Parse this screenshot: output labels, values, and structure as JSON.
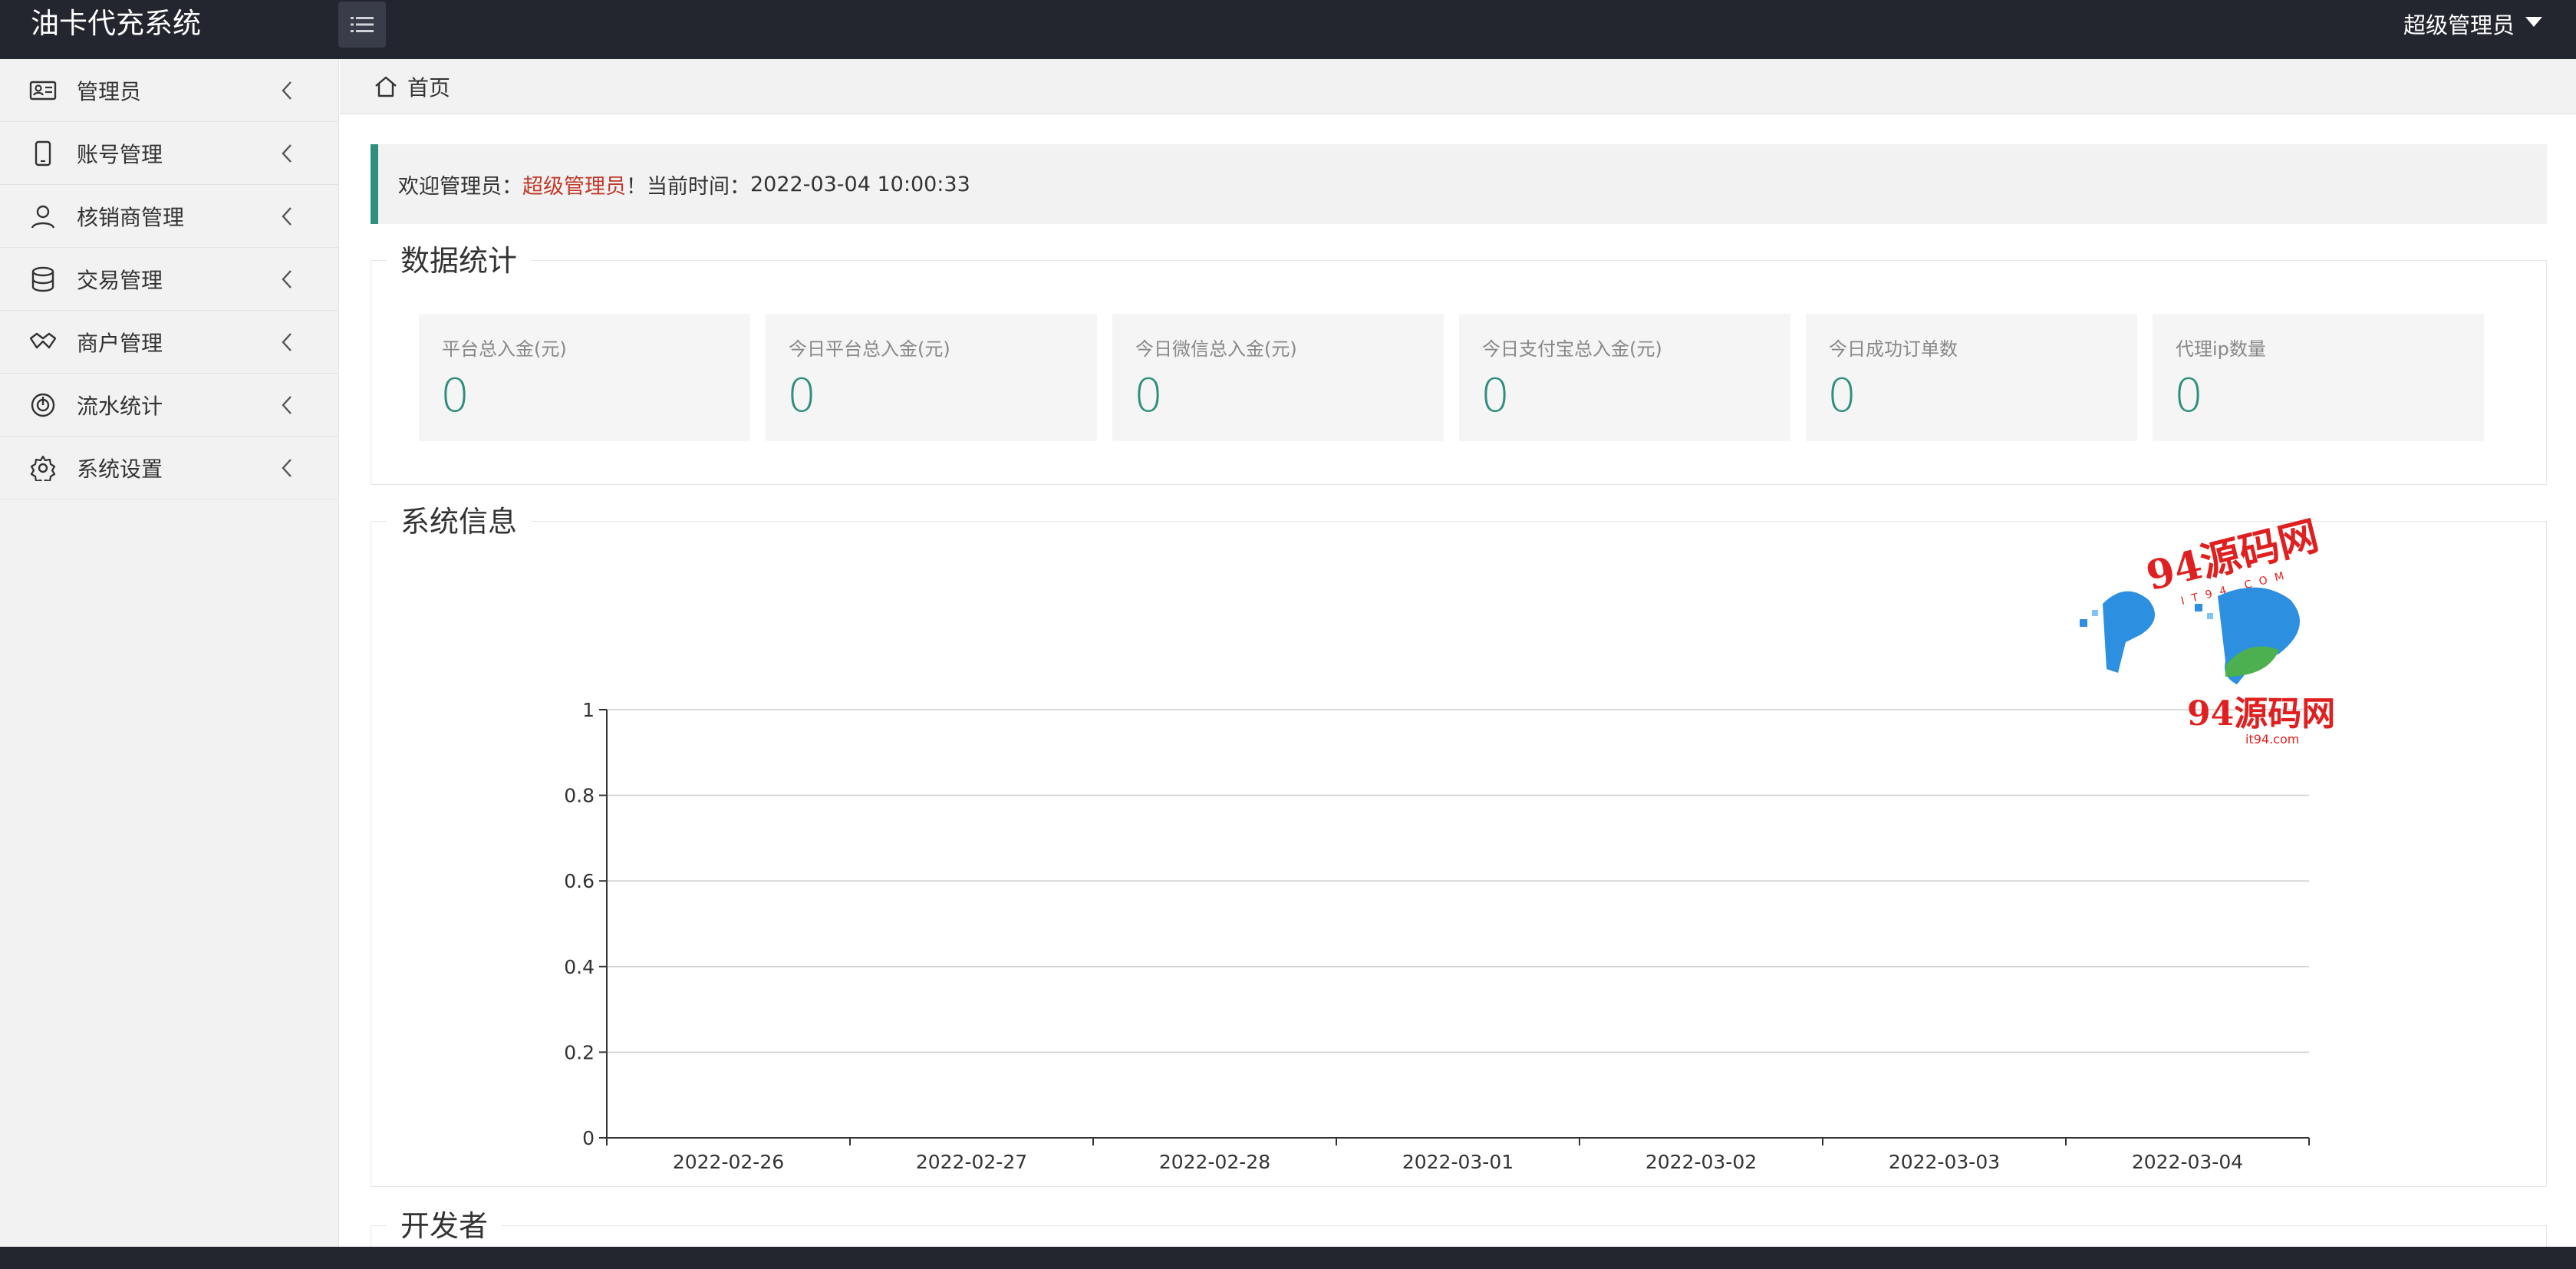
{
  "app": {
    "title": "油卡代充系统"
  },
  "header": {
    "user_label": "超级管理员"
  },
  "sidebar": {
    "items": [
      {
        "label": "管理员",
        "icon": "id-card-icon"
      },
      {
        "label": "账号管理",
        "icon": "phone-icon"
      },
      {
        "label": "核销商管理",
        "icon": "user-icon"
      },
      {
        "label": "交易管理",
        "icon": "database-icon"
      },
      {
        "label": "商户管理",
        "icon": "handshake-icon"
      },
      {
        "label": "流水统计",
        "icon": "dial-icon"
      },
      {
        "label": "系统设置",
        "icon": "gear-icon"
      }
    ]
  },
  "breadcrumb": {
    "home": "首页"
  },
  "welcome": {
    "prefix": "欢迎管理员：",
    "admin": "超级管理员",
    "middle": "！当前时间：",
    "time": "2022-03-04 10:00:33"
  },
  "stats": {
    "title": "数据统计",
    "cards": [
      {
        "label": "平台总入金(元)",
        "value": "0"
      },
      {
        "label": "今日平台总入金(元)",
        "value": "0"
      },
      {
        "label": "今日微信总入金(元)",
        "value": "0"
      },
      {
        "label": "今日支付宝总入金(元)",
        "value": "0"
      },
      {
        "label": "今日成功订单数",
        "value": "0"
      },
      {
        "label": "代理ip数量",
        "value": "0"
      }
    ]
  },
  "sysinfo": {
    "title": "系统信息"
  },
  "developer": {
    "title": "开发者"
  },
  "watermark": {
    "text": "94源码网",
    "sub": "it94.com",
    "sub2": "IT94.COM"
  },
  "colors": {
    "accent": "#2f8f7c",
    "admin_highlight": "#c0392b",
    "topbar": "#23262e"
  },
  "chart_data": {
    "type": "line",
    "categories": [
      "2022-02-26",
      "2022-02-27",
      "2022-02-28",
      "2022-03-01",
      "2022-03-02",
      "2022-03-03",
      "2022-03-04"
    ],
    "series": [],
    "yticks": [
      "0",
      "0.2",
      "0.4",
      "0.6",
      "0.8",
      "1"
    ],
    "ylim": [
      0,
      1
    ],
    "grid": true
  }
}
